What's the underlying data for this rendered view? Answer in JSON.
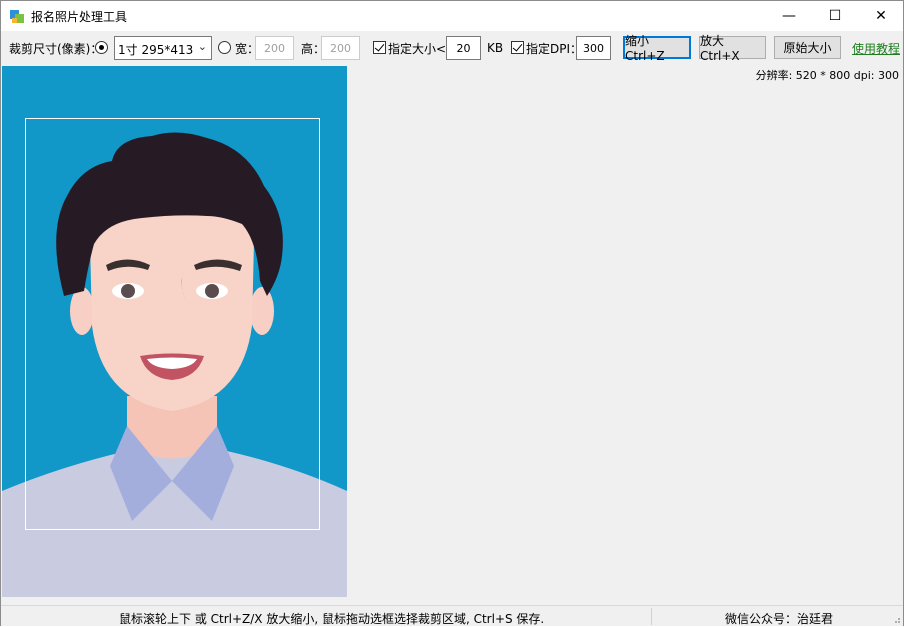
{
  "window": {
    "title": "报名照片处理工具",
    "minimize_glyph": "—",
    "maximize_glyph": "☐",
    "close_glyph": "✕"
  },
  "toolbar": {
    "crop_size_label": "裁剪尺寸(像素)：",
    "preset_select_value": "1寸  295*413",
    "width_label": "宽：",
    "width_value": "200",
    "height_label": "高：",
    "height_value": "200",
    "size_limit_label": "指定大小<",
    "size_limit_value": "20",
    "size_unit": "KB",
    "dpi_label": "指定DPI：",
    "dpi_value": "300",
    "zoom_out_label": "缩小 Ctrl+Z",
    "zoom_in_label": "放大 Ctrl+X",
    "original_size_label": "原始大小",
    "tutorial_link": "使用教程"
  },
  "canvas": {
    "resolution_info": "分辨率: 520 * 800 dpi: 300",
    "photo_background": "#1197c8"
  },
  "statusbar": {
    "hint": "鼠标滚轮上下 或 Ctrl+Z/X 放大缩小, 鼠标拖动选框选择裁剪区域, Ctrl+S 保存.",
    "wechat": "微信公众号：治廷君"
  }
}
